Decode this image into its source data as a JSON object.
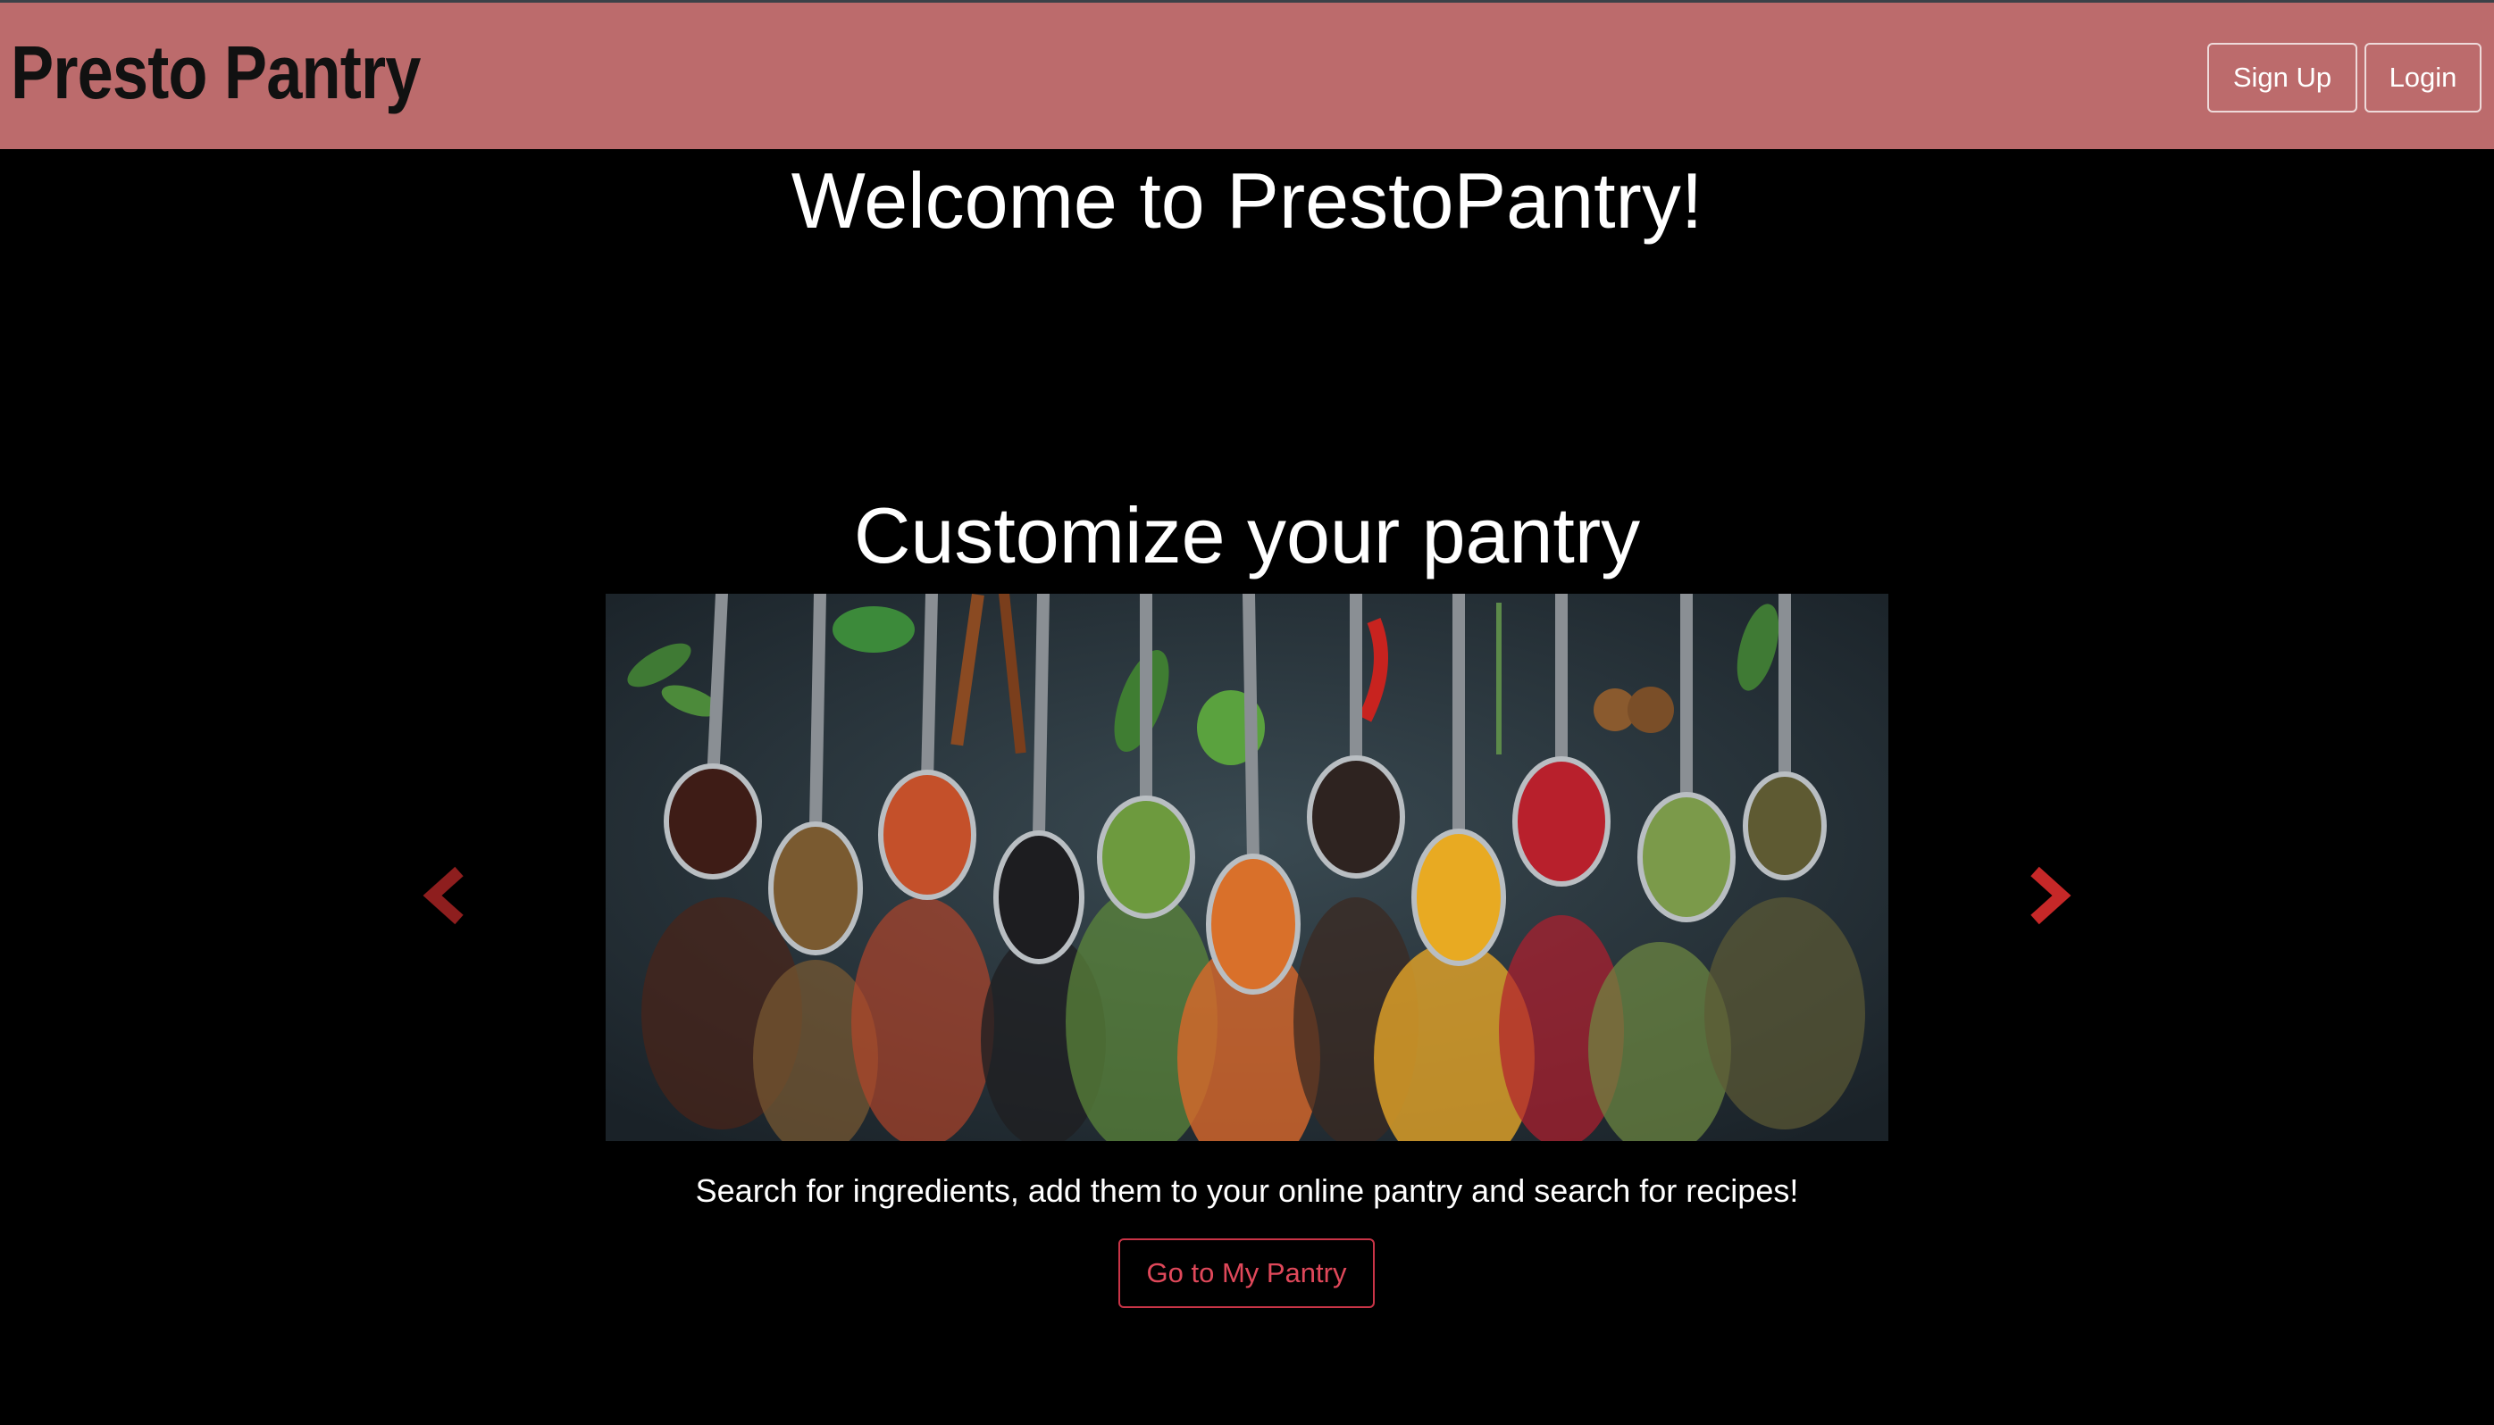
{
  "navbar": {
    "brand": "Presto Pantry",
    "signup_label": "Sign Up",
    "login_label": "Login",
    "background_color": "#bc6b6c"
  },
  "hero": {
    "welcome_title": "Welcome to PrestoPantry!"
  },
  "carousel": {
    "slide_title": "Customize your pantry",
    "slide_image_icon": "spices-on-spoons-photo",
    "prev_icon": "chevron-left-icon",
    "next_icon": "chevron-right-icon",
    "arrow_color": "#c62828",
    "caption": "Search for ingredients, add them to your online pantry and search for recipes!",
    "cta_label": "Go to My Pantry",
    "cta_color": "#e0485a"
  }
}
